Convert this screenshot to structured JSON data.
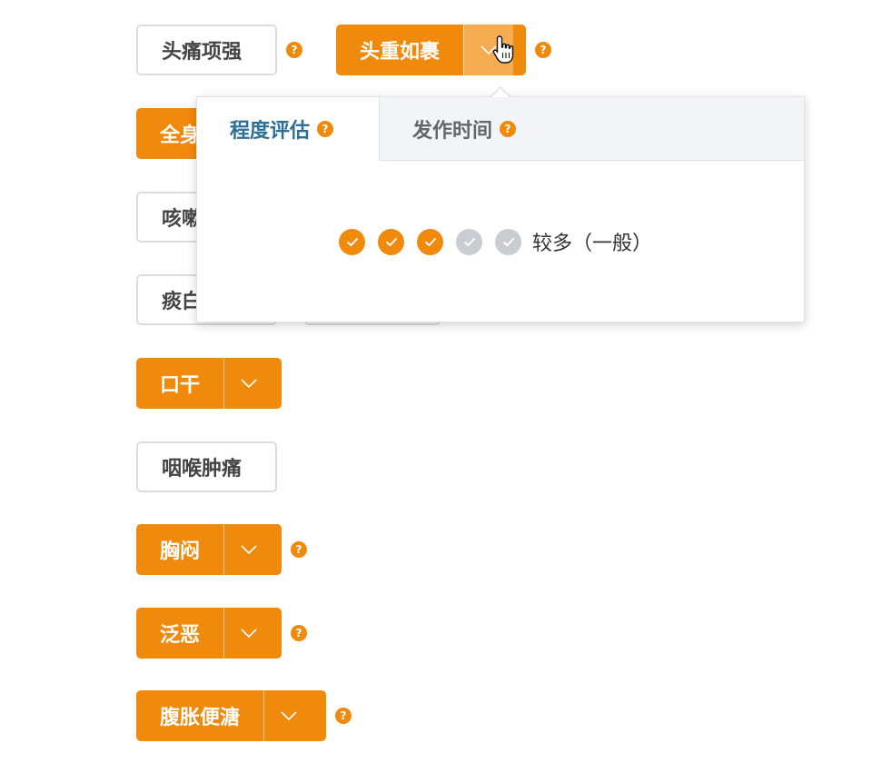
{
  "colors": {
    "accent": "#f08a0c",
    "accent_light": "#f6ad52",
    "tab_active_text": "#2c6f97",
    "dot_off": "#c9ccd1"
  },
  "symptoms": {
    "headache_stiff_neck": "头痛项强",
    "head_heavy": "头重如裹",
    "body_partial": "全身",
    "cough_partial": "咳嗽",
    "phlegm_partial": "痰白",
    "dry_mouth": "口干",
    "sore_throat": "咽喉肿痛",
    "chest_tightness": "胸闷",
    "nausea": "泛恶",
    "bloating_loose_stool": "腹胀便溏"
  },
  "help_glyph": "?",
  "popover": {
    "tabs": [
      "程度评估",
      "发作时间"
    ],
    "rating": {
      "value": 3,
      "max": 5,
      "label": "较多（一般）"
    }
  },
  "icons": {
    "dropdown": "chevron-down-icon",
    "cursor": "hand-pointer-icon",
    "check": "check-icon"
  }
}
